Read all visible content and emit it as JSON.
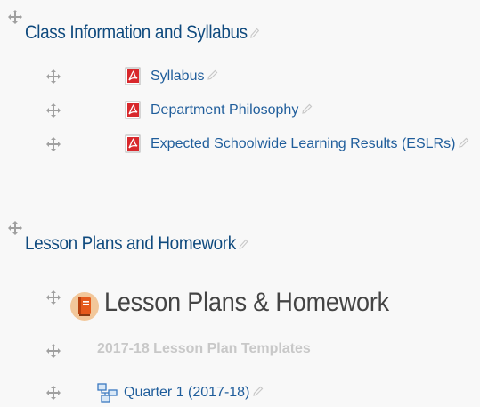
{
  "section1": {
    "title": "Class Information and Syllabus",
    "items": [
      {
        "label": "Syllabus"
      },
      {
        "label": "Department Philosophy"
      },
      {
        "label": "Expected Schoolwide Learning Results (ESLRs)"
      }
    ]
  },
  "section2": {
    "title": "Lesson Plans and Homework",
    "page_title": "Lesson Plans & Homework",
    "subheading": "2017-18 Lesson Plan Templates",
    "folder_link": "Quarter 1 (2017-18)"
  },
  "colors": {
    "section_title": "#0f4a7e",
    "link": "#1f5d9b",
    "pdf_red": "#d8282c",
    "notebook_orange": "#e55a1c"
  }
}
